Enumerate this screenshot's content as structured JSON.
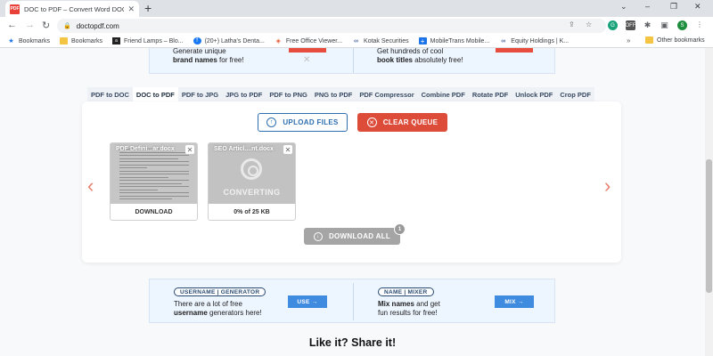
{
  "browser": {
    "tab_title": "DOC to PDF – Convert Word DOC",
    "favicon_text": "PDF",
    "new_tab": "+",
    "url": "doctopdf.com",
    "window_controls": [
      "⌄",
      "–",
      "❐",
      "✕"
    ],
    "profile_initial": "S"
  },
  "bookmarks": {
    "items": [
      {
        "label": "Bookmarks",
        "icon": "star-icon"
      },
      {
        "label": "Bookmarks",
        "icon": "folder-icon"
      },
      {
        "label": "Friend Lamps – Blo...",
        "icon": "lamp-icon"
      },
      {
        "label": "(20+) Latha's Denta...",
        "icon": "facebook-icon"
      },
      {
        "label": "Free Office Viewer...",
        "icon": "office-icon"
      },
      {
        "label": "Kotak Securities",
        "icon": "kotak-icon"
      },
      {
        "label": "MobileTrans Mobile...",
        "icon": "plus-icon"
      },
      {
        "label": "Equity Holdings | K...",
        "icon": "kotak-icon"
      }
    ],
    "more": "»",
    "other": "Other bookmarks"
  },
  "top_ad": {
    "left_line1": "Generate unique",
    "left_bold": "brand names",
    "left_rest": " for free!",
    "right_line1": "Get hundreds of cool",
    "right_bold": "book titles",
    "right_rest": " absolutely free!"
  },
  "tool_tabs": [
    {
      "label": "PDF to DOC",
      "active": false
    },
    {
      "label": "DOC to PDF",
      "active": true
    },
    {
      "label": "PDF to JPG",
      "active": false
    },
    {
      "label": "JPG to PDF",
      "active": false
    },
    {
      "label": "PDF to PNG",
      "active": false
    },
    {
      "label": "PNG to PDF",
      "active": false
    },
    {
      "label": "PDF Compressor",
      "active": false
    },
    {
      "label": "Combine PDF",
      "active": false
    },
    {
      "label": "Rotate PDF",
      "active": false
    },
    {
      "label": "Unlock PDF",
      "active": false
    },
    {
      "label": "Crop PDF",
      "active": false
    }
  ],
  "converter": {
    "upload_label": "UPLOAD FILES",
    "clear_label": "CLEAR QUEUE",
    "prev_arrow": "‹",
    "next_arrow": "›",
    "files": [
      {
        "name": "PDF Defini...ar.docx",
        "status": "DOWNLOAD"
      },
      {
        "name": "SEO Articl....nt.docx",
        "overlay": "CONVERTING",
        "status": "0% of 25 KB"
      }
    ],
    "download_all_label": "DOWNLOAD ALL",
    "download_count": "1"
  },
  "bottom_ad": {
    "left_pill": [
      "USERNAME",
      "GENERATOR"
    ],
    "left_line1": "There are a lot of free",
    "left_bold": "username",
    "left_rest": " generators here!",
    "left_btn": "USE →",
    "right_pill": [
      "NAME",
      "MIXER"
    ],
    "right_line1_bold": "Mix names",
    "right_line1_rest": " and get",
    "right_line2": "fun results for free!",
    "right_btn": "MIX →"
  },
  "share_heading": "Like it? Share it!",
  "colors": {
    "accent_blue": "#2e6fb2",
    "clear_red": "#dd4b39",
    "arrow_coral": "#e8806f",
    "disabled_gray": "#a5a5a5"
  }
}
